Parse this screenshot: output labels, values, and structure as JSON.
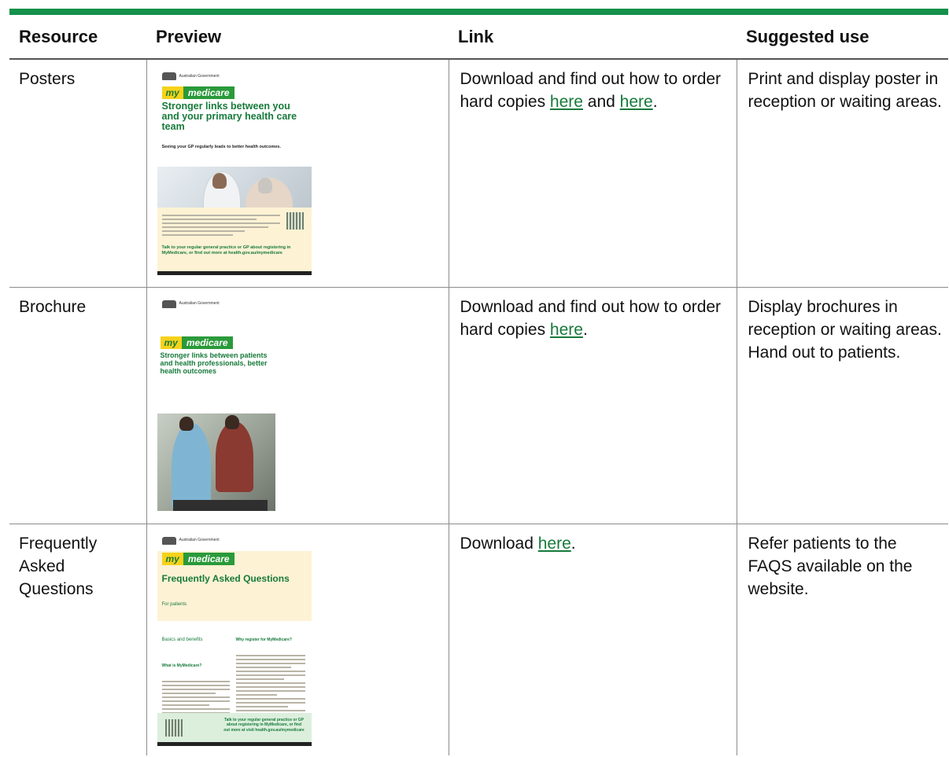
{
  "headers": {
    "resource": "Resource",
    "preview": "Preview",
    "link": "Link",
    "use": "Suggested use"
  },
  "rows": [
    {
      "resource": "Posters",
      "link": {
        "pre": "Download and find out how to order hard copies ",
        "link1": "here",
        "mid": " and ",
        "link2": "here",
        "post": "."
      },
      "use": "Print and display poster in reception or waiting areas.",
      "preview": {
        "gov": "Australian Government",
        "my": "my",
        "medicare": "medicare",
        "title": "Stronger links between you and your primary health care team",
        "subtitle": "Seeing your GP regularly leads to better health outcomes.",
        "footer": "Talk to your regular general practice or GP about registering in MyMedicare, or find out more at health.gov.au/mymedicare"
      }
    },
    {
      "resource": "Brochure",
      "link": {
        "pre": "Download and find out how to order hard copies ",
        "link1": "here",
        "post": "."
      },
      "use": "Display brochures in reception or waiting areas. Hand out to patients.",
      "preview": {
        "gov": "Australian Government",
        "my": "my",
        "medicare": "medicare",
        "title": "Stronger links between patients and health professionals, better health outcomes"
      }
    },
    {
      "resource": "Frequently Asked Questions",
      "link": {
        "pre": "Download ",
        "link1": "here",
        "post": "."
      },
      "use": "Refer patients to the FAQS available on the website.",
      "preview": {
        "gov": "Australian Government",
        "my": "my",
        "medicare": "medicare",
        "title": "Frequently Asked Questions",
        "subtitle": "For patients",
        "h1": "Basics and benefits",
        "h2": "What is MyMedicare?",
        "h3": "Why register for MyMedicare?",
        "footer": "Talk to your regular general practice or GP about registering in MyMedicare, or find out more at visit health.gov.au/mymedicare"
      }
    }
  ],
  "colors": {
    "accent": "#14914a",
    "link": "#177a3a",
    "brand_yellow": "#f6d21a",
    "brand_green": "#2a9a3a"
  }
}
